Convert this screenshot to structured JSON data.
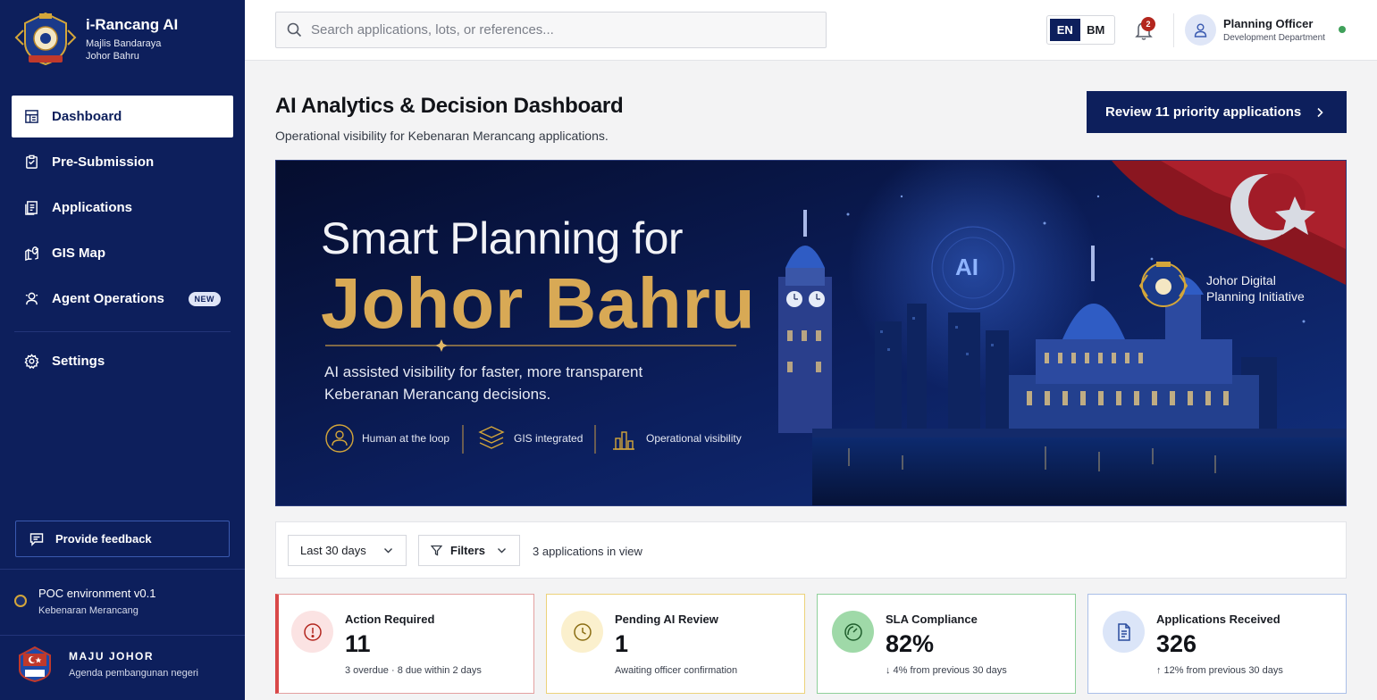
{
  "brand": {
    "title": "i-Rancang AI",
    "sub_line1": "Majlis Bandaraya",
    "sub_line2": "Johor Bahru"
  },
  "sidebar": {
    "items": [
      {
        "label": "Dashboard",
        "icon": "dashboard-icon",
        "active": true
      },
      {
        "label": "Pre-Submission",
        "icon": "clipboard-icon"
      },
      {
        "label": "Applications",
        "icon": "documents-icon"
      },
      {
        "label": "GIS Map",
        "icon": "map-icon"
      },
      {
        "label": "Agent Operations",
        "icon": "agent-icon",
        "badge": "NEW"
      },
      {
        "label": "Settings",
        "icon": "gear-icon"
      }
    ],
    "feedback_label": "Provide feedback",
    "env_title": "POC environment v0.1",
    "env_sub": "Kebenaran Merancang",
    "maju_title": "MAJU JOHOR",
    "maju_sub": "Agenda pembangunan negeri"
  },
  "topbar": {
    "search_placeholder": "Search applications, lots, or references...",
    "lang_active": "EN",
    "lang_other": "BM",
    "notification_count": "2",
    "user_name": "Planning Officer",
    "user_dept": "Development Department"
  },
  "header": {
    "title": "AI Analytics & Decision Dashboard",
    "subtitle": "Operational visibility for Kebenaran Merancang applications.",
    "cta_label": "Review 11 priority applications"
  },
  "banner": {
    "line1": "Smart Planning for",
    "line2": "Johor Bahru",
    "description": "AI assisted visibility for faster, more transparent Keberanan Merancang decisions.",
    "ai_badge": "AI",
    "features": [
      "Human at the loop",
      "GIS integrated",
      "Operational visibility"
    ],
    "initiative_line1": "Johor Digital",
    "initiative_line2": "Planning Initiative"
  },
  "filters": {
    "range_label": "Last 30 days",
    "filters_label": "Filters",
    "count_text": "3 applications in view"
  },
  "kpis": [
    {
      "label": "Action Required",
      "value": "11",
      "note": "3 overdue · 8 due within 2 days",
      "accent": "#e05a5a",
      "icon": "alert-icon"
    },
    {
      "label": "Pending AI Review",
      "value": "1",
      "note": "Awaiting officer confirmation",
      "accent": "#e6c14a",
      "icon": "clock-icon"
    },
    {
      "label": "SLA Compliance",
      "value": "82%",
      "note": "↓ 4% from previous 30 days",
      "accent": "#5fb86c",
      "icon": "gauge-icon"
    },
    {
      "label": "Applications Received",
      "value": "326",
      "note": "↑ 12% from previous 30 days",
      "accent": "#8aa6e0",
      "icon": "document-icon"
    }
  ]
}
